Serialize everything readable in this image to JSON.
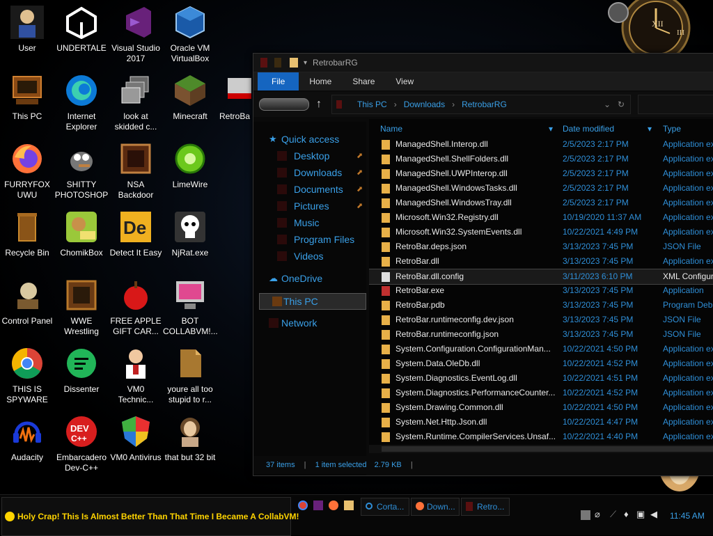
{
  "desktop_icons": [
    {
      "label": "User",
      "icon": "user-icon"
    },
    {
      "label": "UNDERTALE",
      "icon": "unity-icon"
    },
    {
      "label": "Visual Studio\n2017",
      "icon": "visual-studio-icon"
    },
    {
      "label": "Oracle VM\nVirtualBox",
      "icon": "virtualbox-icon"
    },
    {
      "label": "This PC",
      "icon": "computer-icon"
    },
    {
      "label": "Internet\nExplorer",
      "icon": "edge-icon"
    },
    {
      "label": "look at\nskidded c...",
      "icon": "stacked-windows-icon"
    },
    {
      "label": "Minecraft",
      "icon": "grass-block-icon"
    },
    {
      "label": "RetroBa",
      "icon": "retrobar-icon"
    },
    {
      "label": "FURRYFOX\nUWU",
      "icon": "firefox-icon"
    },
    {
      "label": "SHITTY\nPHOTOSHOP",
      "icon": "gimp-icon"
    },
    {
      "label": "NSA\nBackdoor",
      "icon": "frame-icon"
    },
    {
      "label": "LimeWire",
      "icon": "limewire-icon"
    },
    {
      "label": "Recycle Bin",
      "icon": "recycle-bin-icon"
    },
    {
      "label": "ChomikBox",
      "icon": "chomikbox-icon"
    },
    {
      "label": "Detect It Easy",
      "icon": "die-icon"
    },
    {
      "label": "NjRat.exe",
      "icon": "skull-icon"
    },
    {
      "label": "Control Panel",
      "icon": "control-panel-icon"
    },
    {
      "label": "WWE\nWrestling",
      "icon": "wwe-icon"
    },
    {
      "label": "FREE APPLE\nGIFT CAR...",
      "icon": "apple-icon"
    },
    {
      "label": "BOT\nCOLLABVM!...",
      "icon": "monitor-icon"
    },
    {
      "label": "THIS IS\nSPYWARE",
      "icon": "chrome-icon"
    },
    {
      "label": "Dissenter",
      "icon": "dissenter-icon"
    },
    {
      "label": "VM0\nTechnic...",
      "icon": "technician-icon"
    },
    {
      "label": "youre all too\nstupid to r...",
      "icon": "document-icon"
    },
    {
      "label": "Audacity",
      "icon": "audacity-icon"
    },
    {
      "label": "Embarcadero\nDev-C++",
      "icon": "devcpp-icon"
    },
    {
      "label": "VM0 Antivirus",
      "icon": "shield-icon"
    },
    {
      "label": "that but 32 bit",
      "icon": "portrait-icon"
    }
  ],
  "explorer": {
    "title": "RetrobarRG",
    "ribbon_tabs": [
      "File",
      "Home",
      "Share",
      "View"
    ],
    "breadcrumb": [
      "This PC",
      "Downloads",
      "RetrobarRG"
    ],
    "nav": {
      "quick_access": "Quick access",
      "pinned": [
        "Desktop",
        "Downloads",
        "Documents",
        "Pictures"
      ],
      "folders": [
        "Music",
        "Program Files",
        "Videos"
      ],
      "onedrive": "OneDrive",
      "this_pc": "This PC",
      "network": "Network"
    },
    "columns": {
      "name": "Name",
      "date": "Date modified",
      "type": "Type"
    },
    "files": [
      {
        "name": "ManagedShell.Interop.dll",
        "date": "2/5/2023 2:17 PM",
        "type": "Application ex"
      },
      {
        "name": "ManagedShell.ShellFolders.dll",
        "date": "2/5/2023 2:17 PM",
        "type": "Application ex"
      },
      {
        "name": "ManagedShell.UWPInterop.dll",
        "date": "2/5/2023 2:17 PM",
        "type": "Application ex"
      },
      {
        "name": "ManagedShell.WindowsTasks.dll",
        "date": "2/5/2023 2:17 PM",
        "type": "Application ex"
      },
      {
        "name": "ManagedShell.WindowsTray.dll",
        "date": "2/5/2023 2:17 PM",
        "type": "Application ex"
      },
      {
        "name": "Microsoft.Win32.Registry.dll",
        "date": "10/19/2020 11:37 AM",
        "type": "Application ex"
      },
      {
        "name": "Microsoft.Win32.SystemEvents.dll",
        "date": "10/22/2021 4:49 PM",
        "type": "Application ex"
      },
      {
        "name": "RetroBar.deps.json",
        "date": "3/13/2023 7:45 PM",
        "type": "JSON File"
      },
      {
        "name": "RetroBar.dll",
        "date": "3/13/2023 7:45 PM",
        "type": "Application ex"
      },
      {
        "name": "RetroBar.dll.config",
        "date": "3/11/2023 6:10 PM",
        "type": "XML Configur"
      },
      {
        "name": "RetroBar.exe",
        "date": "3/13/2023 7:45 PM",
        "type": "Application"
      },
      {
        "name": "RetroBar.pdb",
        "date": "3/13/2023 7:45 PM",
        "type": "Program Debu"
      },
      {
        "name": "RetroBar.runtimeconfig.dev.json",
        "date": "3/13/2023 7:45 PM",
        "type": "JSON File"
      },
      {
        "name": "RetroBar.runtimeconfig.json",
        "date": "3/13/2023 7:45 PM",
        "type": "JSON File"
      },
      {
        "name": "System.Configuration.ConfigurationMan...",
        "date": "10/22/2021 4:50 PM",
        "type": "Application ex"
      },
      {
        "name": "System.Data.OleDb.dll",
        "date": "10/22/2021 4:52 PM",
        "type": "Application ex"
      },
      {
        "name": "System.Diagnostics.EventLog.dll",
        "date": "10/22/2021 4:51 PM",
        "type": "Application ex"
      },
      {
        "name": "System.Diagnostics.PerformanceCounter...",
        "date": "10/22/2021 4:52 PM",
        "type": "Application ex"
      },
      {
        "name": "System.Drawing.Common.dll",
        "date": "10/22/2021 4:50 PM",
        "type": "Application ex"
      },
      {
        "name": "System.Net.Http.Json.dll",
        "date": "10/22/2021 4:47 PM",
        "type": "Application ex"
      },
      {
        "name": "System.Runtime.CompilerServices.Unsaf...",
        "date": "10/22/2021 4:40 PM",
        "type": "Application ex"
      }
    ],
    "selected_index": 9,
    "status": {
      "items": "37 items",
      "selected": "1 item selected",
      "size": "2.79 KB"
    }
  },
  "taskbar": {
    "start_text": "Holy Crap! This Is Almost Better Than That Time I Became A CollabVM!",
    "quicklaunch": [
      "chrome-icon",
      "visual-studio-icon",
      "firefox-icon",
      "explorer-icon"
    ],
    "buttons": [
      {
        "label": "Corta...",
        "icon": "cortana-icon"
      },
      {
        "label": "Down...",
        "icon": "firefox-icon"
      },
      {
        "label": "Retro...",
        "icon": "retrobar-icon"
      }
    ],
    "clock": "11:45 AM"
  },
  "colors": {
    "accent": "#1565c0",
    "link_blue": "#3aa0e8",
    "bg": "#000000",
    "start_yellow": "#ffd400"
  }
}
